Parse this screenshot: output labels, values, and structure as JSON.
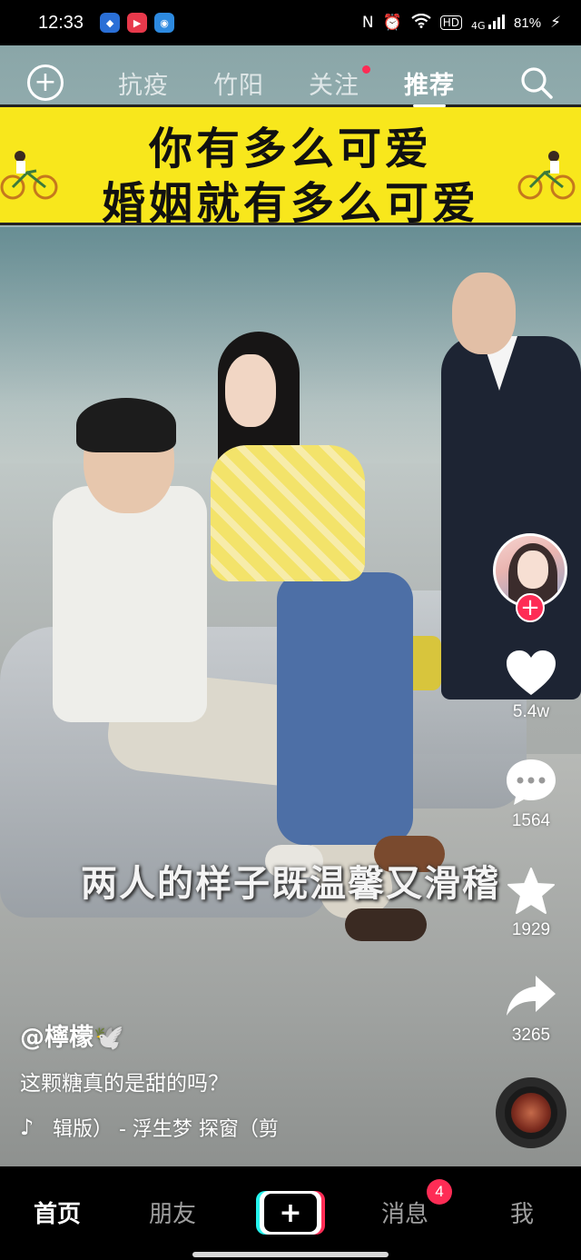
{
  "status_bar": {
    "time": "12:33",
    "battery": "81%",
    "network": "4G",
    "hd": "HD"
  },
  "top_nav": {
    "tabs": [
      {
        "label": "抗疫",
        "active": false
      },
      {
        "label": "竹阳",
        "active": false
      },
      {
        "label": "关注",
        "active": false,
        "dot": true
      },
      {
        "label": "推荐",
        "active": true
      }
    ]
  },
  "banner": {
    "line1": "你有多么可爱",
    "line2": "婚姻就有多么可爱"
  },
  "subtitle": "两人的样子既温馨又滑稽",
  "rail": {
    "likes": "5.4w",
    "comments": "1564",
    "favorites": "1929",
    "shares": "3265"
  },
  "caption": {
    "author": "@檸檬🕊️",
    "description": "这颗糖真的是甜的吗？",
    "music": "辑版） - 浮生梦  探窗（剪"
  },
  "bottom_nav": {
    "home": "首页",
    "friends": "朋友",
    "create": "+",
    "messages": "消息",
    "messages_badge": "4",
    "me": "我"
  },
  "colors": {
    "accent": "#fe2c55",
    "cyan": "#25f4ee",
    "banner": "#f8e71c"
  }
}
